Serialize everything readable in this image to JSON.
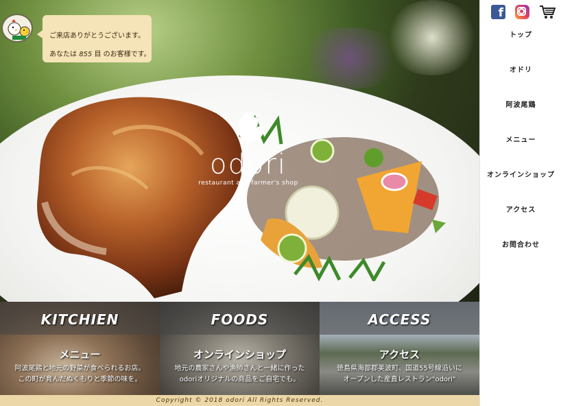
{
  "welcome": {
    "line1": "ご来店ありがとうございます。",
    "line2_prefix": "あなたは ",
    "count": "855",
    "line2_suffix": " 目 のお客様です。"
  },
  "logo": {
    "word": "odori",
    "tagline": "restaurant and farmer's shop"
  },
  "panels": [
    {
      "title": "KITCHIEN",
      "subtitle": "メニュー",
      "desc1": "阿波尾鶏と地元の野菜が食べられるお店。",
      "desc2": "この町が育んだぬくもりと季節の味を。"
    },
    {
      "title": "FOODS",
      "subtitle": "オンラインショップ",
      "desc1": "地元の農家さんや漁師さんと一緒に作った",
      "desc2": "odoriオリジナルの商品をご自宅でも。"
    },
    {
      "title": "ACCESS",
      "subtitle": "アクセス",
      "desc1": "徳島県海部郡美波町、国道55号線沿いに",
      "desc2": "オープンした産直レストラン\"odori\""
    }
  ],
  "footer": "Copyright ©  2018 odori All Rights Reserved.",
  "nav": [
    "トップ",
    "オドリ",
    "阿波尾鶏",
    "メニュー",
    "オンラインショップ",
    "アクセス",
    "お問合わせ"
  ],
  "icons": [
    "facebook-icon",
    "instagram-icon",
    "cart-icon"
  ],
  "colors": {
    "bubble": "#f5e4b8",
    "footer": "#ecd7a8",
    "facebook": "#3b5998"
  }
}
